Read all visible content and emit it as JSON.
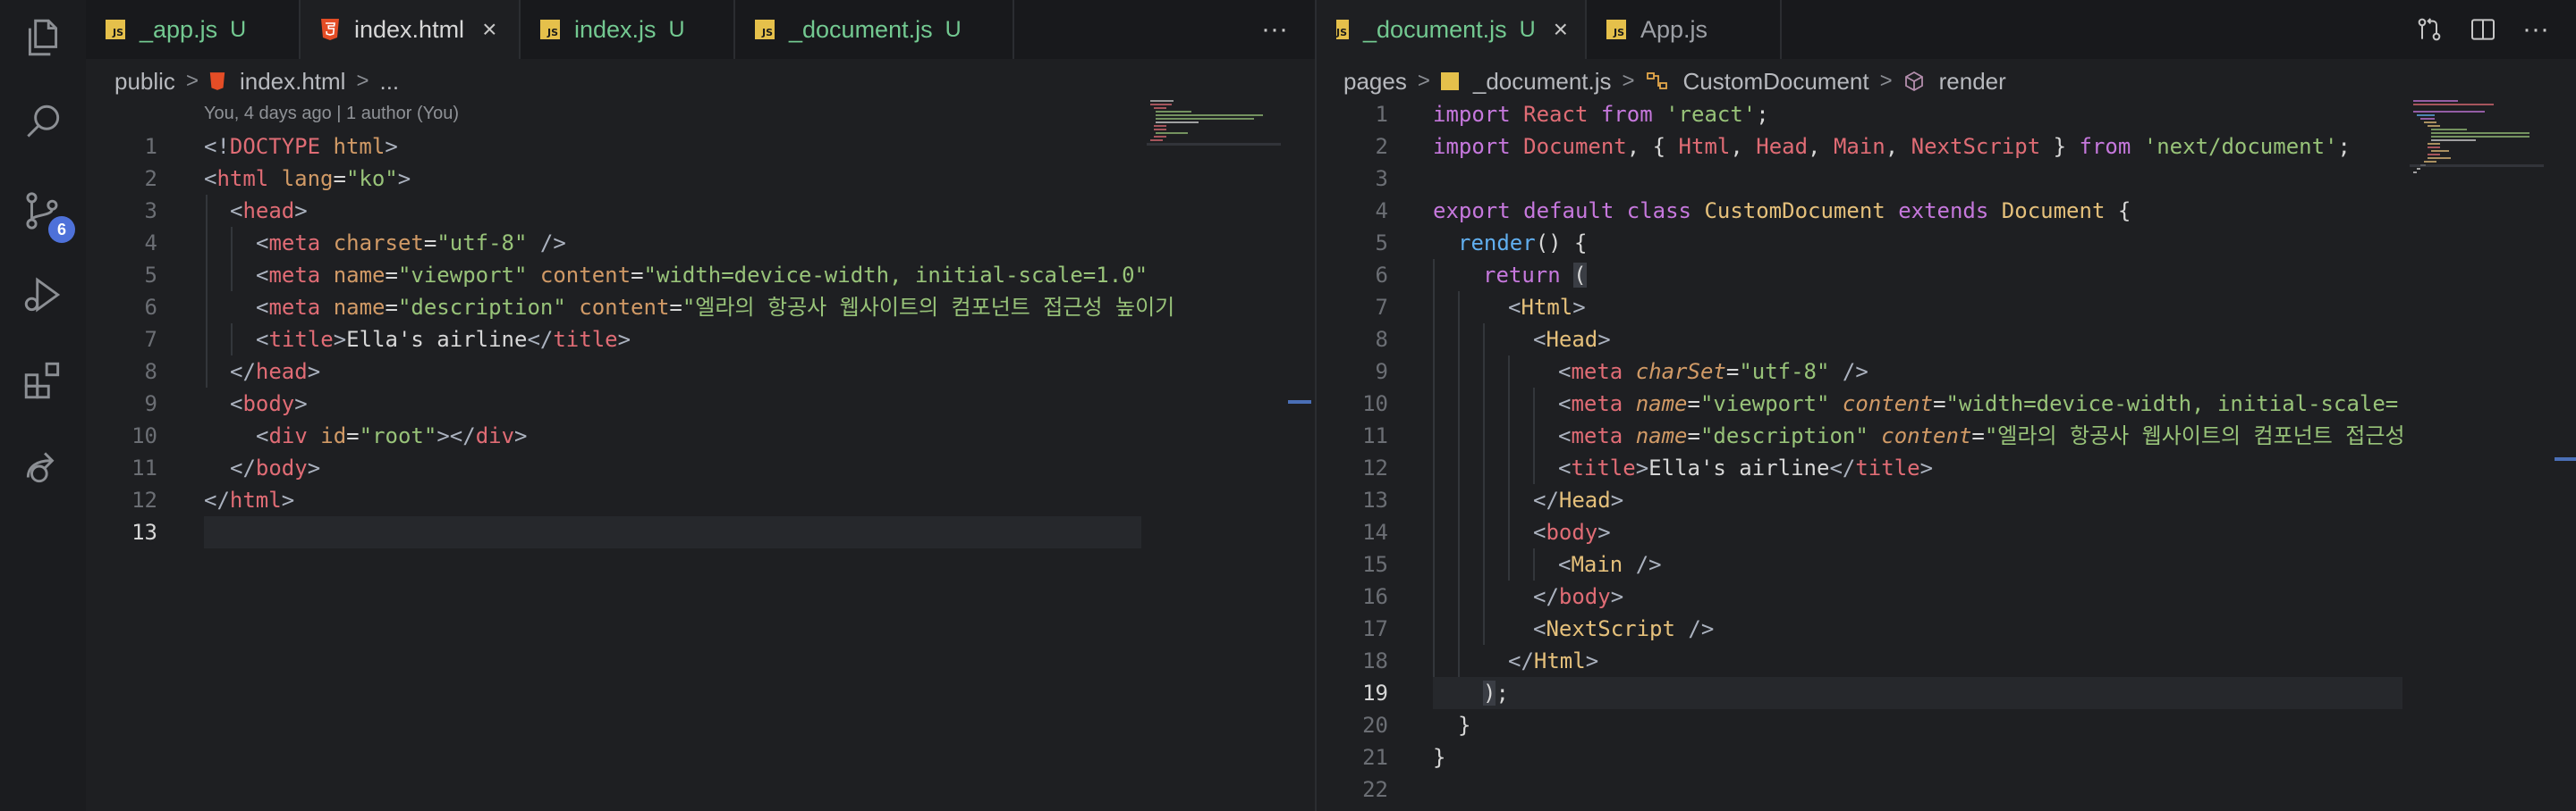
{
  "activity": {
    "items": [
      "explorer-icon",
      "search-icon",
      "source-control-icon",
      "run-debug-icon",
      "extensions-icon",
      "remote-icon"
    ],
    "scm_badge": "6"
  },
  "left_editor": {
    "tabs": [
      {
        "label": "_app.js",
        "kind": "js",
        "status": "U"
      },
      {
        "label": "index.html",
        "kind": "html",
        "status": "",
        "close": "×"
      },
      {
        "label": "index.js",
        "kind": "js",
        "status": "U"
      },
      {
        "label": "_document.js",
        "kind": "js",
        "status": "U"
      }
    ],
    "more": "···",
    "breadcrumb": [
      "public",
      "index.html",
      "..."
    ],
    "blame": "You, 4 days ago | 1 author (You)",
    "line_numbers": [
      "1",
      "2",
      "3",
      "4",
      "5",
      "6",
      "7",
      "8",
      "9",
      "10",
      "11",
      "12",
      "13"
    ],
    "current_line": "13"
  },
  "right_editor": {
    "tabs": [
      {
        "label": "_document.js",
        "kind": "js",
        "status": "U",
        "close": "×"
      },
      {
        "label": "App.js",
        "kind": "js",
        "status": ""
      }
    ],
    "more": "···",
    "breadcrumb": [
      "pages",
      "_document.js",
      "CustomDocument",
      "render"
    ],
    "line_numbers": [
      "1",
      "2",
      "3",
      "4",
      "5",
      "6",
      "7",
      "8",
      "9",
      "10",
      "11",
      "12",
      "13",
      "14",
      "15",
      "16",
      "17",
      "18",
      "19",
      "20",
      "21",
      "22"
    ],
    "current_line": "19"
  },
  "colors": {
    "keyword": "#c678dd",
    "tag": "#e06c75",
    "attribute": "#d19a66",
    "string": "#98c379",
    "component": "#e5c07b",
    "function": "#61afef",
    "untracked": "#73c991",
    "badge": "#4e71d9"
  }
}
